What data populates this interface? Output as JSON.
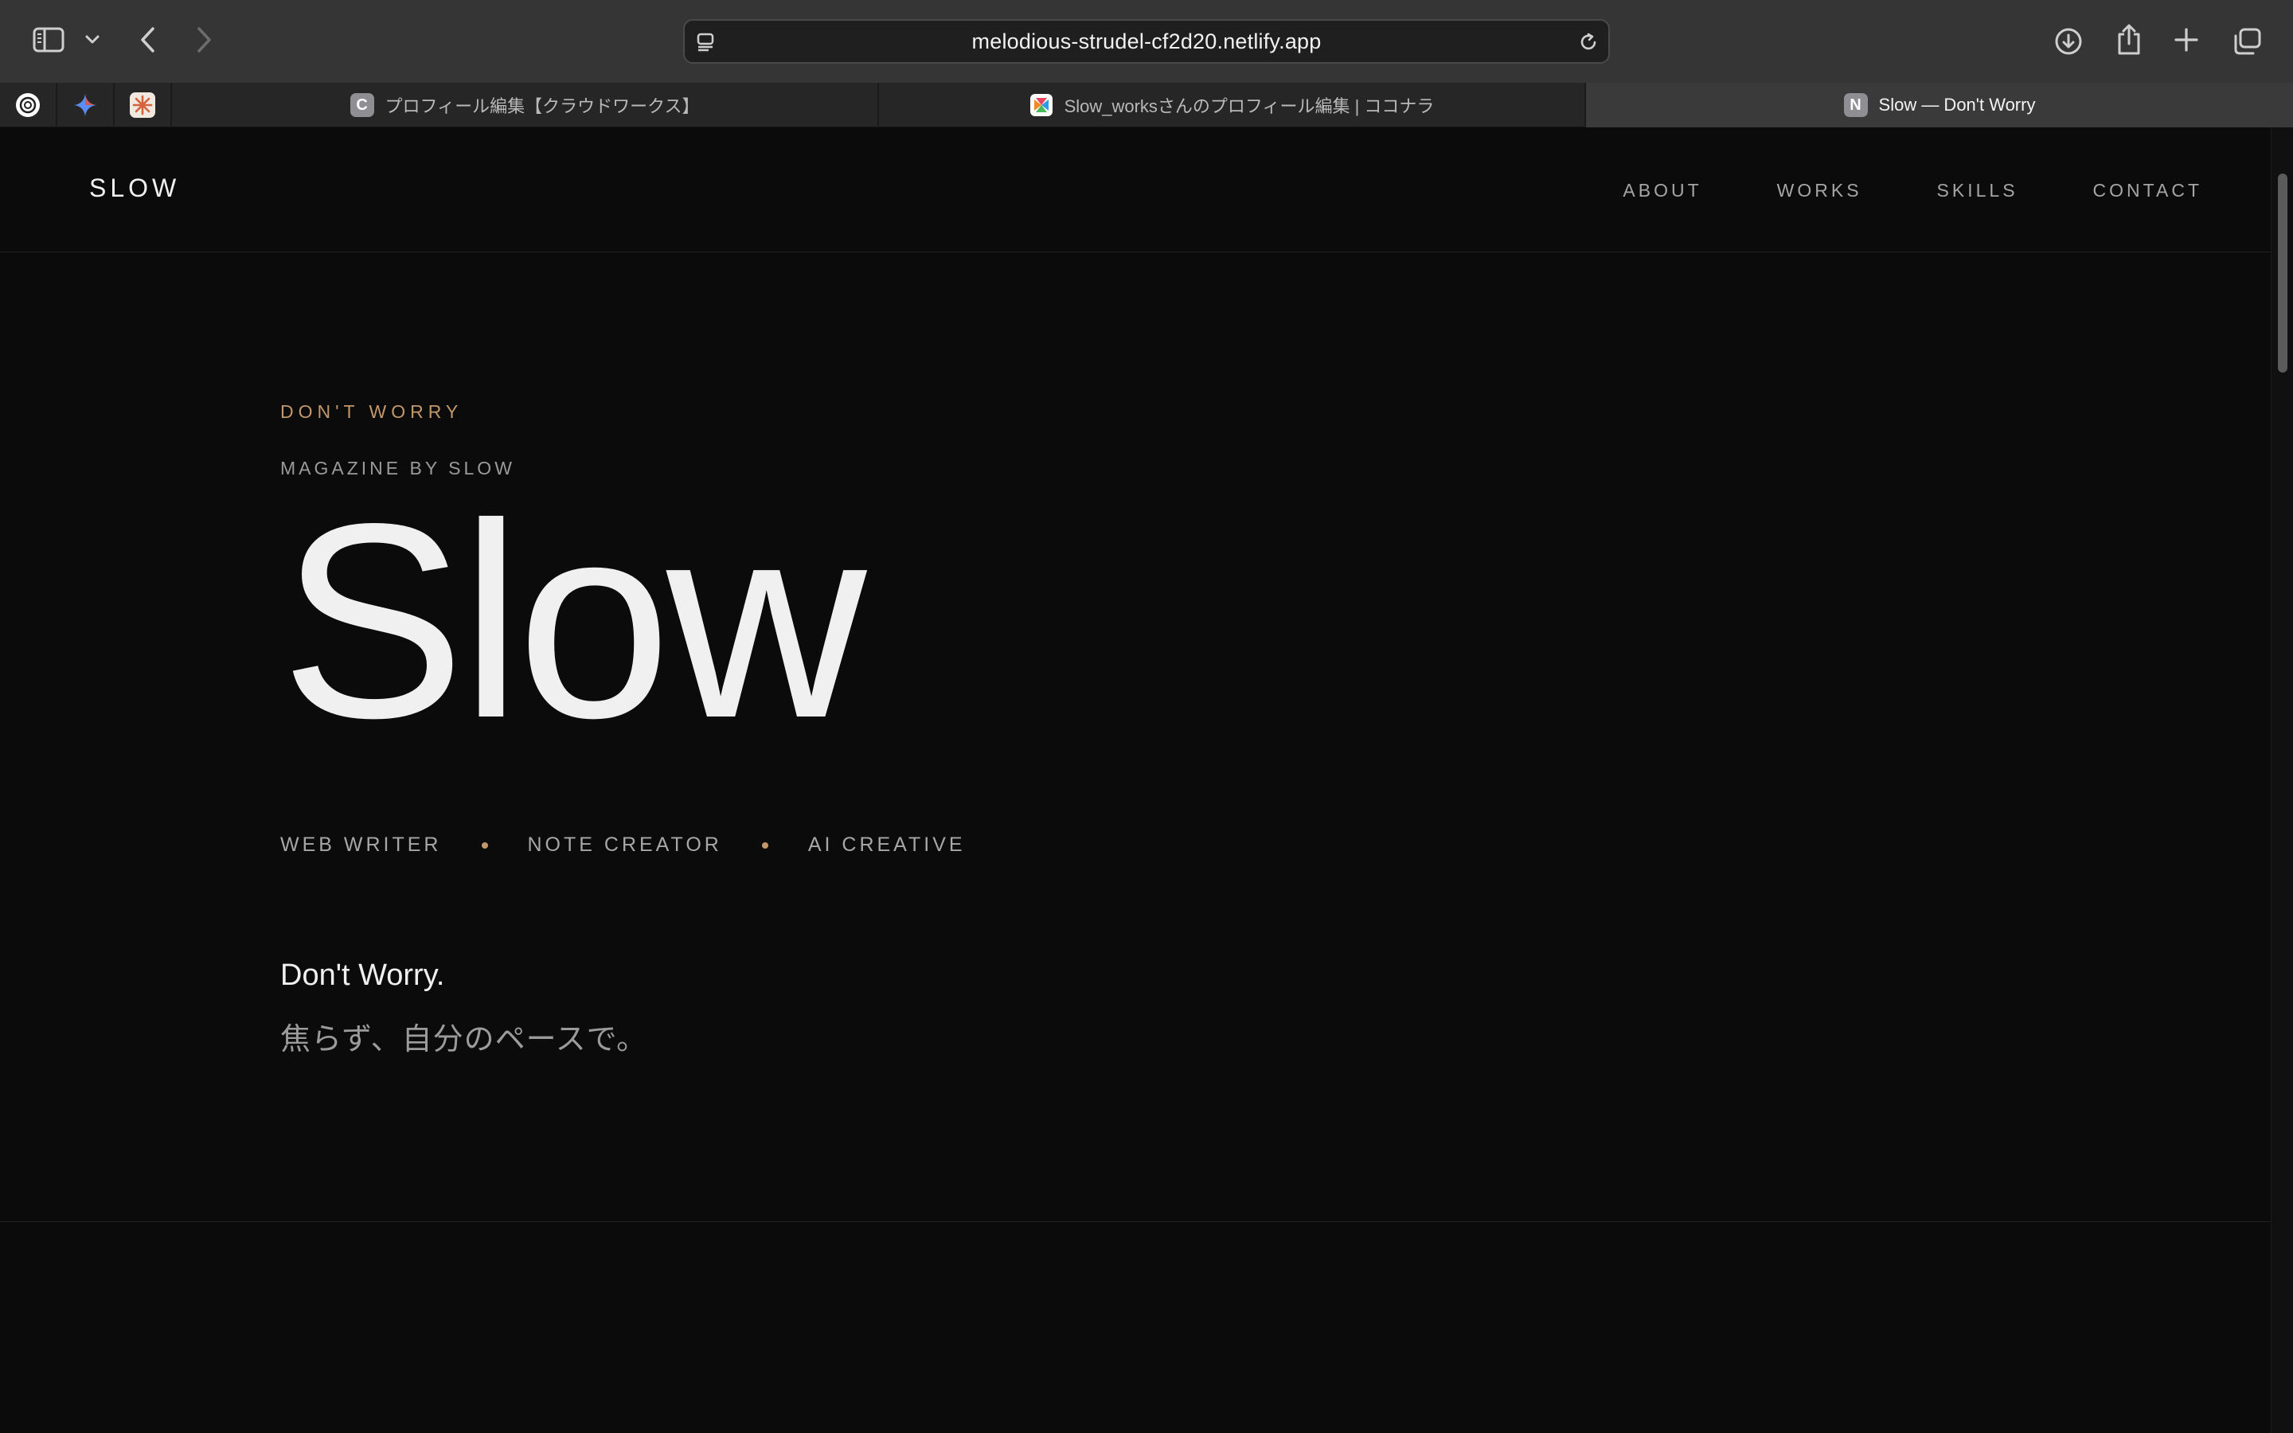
{
  "browser": {
    "url": "melodious-strudel-cf2d20.netlify.app",
    "tabs": [
      {
        "label": "プロフィール編集【クラウドワークス】",
        "icon_letter": "C"
      },
      {
        "label": "Slow_worksさんのプロフィール編集 | ココナラ",
        "icon_letter": ""
      },
      {
        "label": "Slow — Don't Worry",
        "icon_letter": "N",
        "active": true
      }
    ],
    "pinned_tabs": [
      "chatgpt-icon",
      "gemini-icon",
      "claude-icon"
    ]
  },
  "site": {
    "logo": "SLOW",
    "nav": [
      "ABOUT",
      "WORKS",
      "SKILLS",
      "CONTACT"
    ]
  },
  "hero": {
    "eyebrow": "DON'T WORRY",
    "sub_eyebrow": "MAGAZINE BY SLOW",
    "title": "Slow",
    "roles": [
      "WEB WRITER",
      "NOTE CREATOR",
      "AI CREATIVE"
    ],
    "tagline_en": "Don't Worry.",
    "tagline_ja": "焦らず、自分のペースで。"
  },
  "colors": {
    "accent": "#c2976a",
    "background": "#0b0b0b",
    "text": "#f0f0f0",
    "muted": "#9a9a9a"
  }
}
